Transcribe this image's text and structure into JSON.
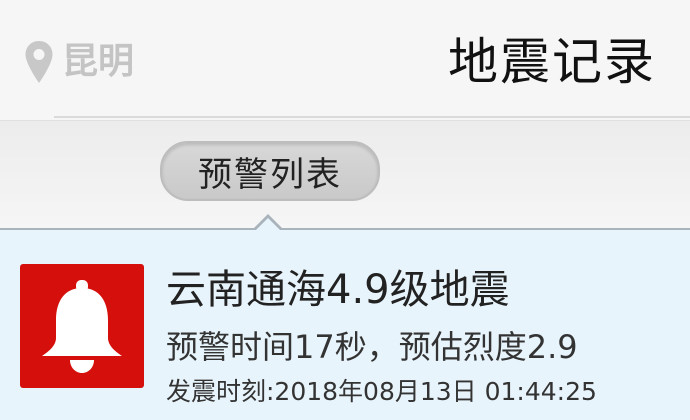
{
  "header": {
    "location": "昆明",
    "title": "地震记录"
  },
  "tabs": {
    "active_label": "预警列表"
  },
  "list": {
    "items": [
      {
        "title": "云南通海4.9级地震",
        "detail": "预警时间17秒，预估烈度2.9",
        "time": "发震时刻:2018年08月13日 01:44:25"
      }
    ]
  },
  "icons": {
    "location": "map-pin-icon",
    "alert": "bell-icon"
  },
  "colors": {
    "alert_badge": "#d40f0c",
    "list_background": "#e8f4fb",
    "location_text": "#c4c4c4"
  }
}
